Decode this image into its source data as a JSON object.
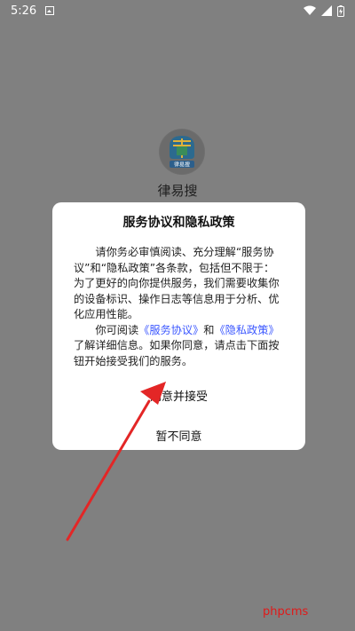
{
  "status_bar": {
    "time": "5:26"
  },
  "app": {
    "name": "律易搜",
    "logo_text": "律易搜"
  },
  "dialog": {
    "title": "服务协议和隐私政策",
    "para1": "请你务必审慎阅读、充分理解“服务协议”和“隐私政策”各条款，包括但不限于：为了更好的向你提供服务，我们需要收集你的设备标识、操作日志等信息用于分析、优化应用性能。",
    "para2_before": "你可阅读",
    "link_service": "《服务协议》",
    "para2_mid": "和",
    "link_privacy": "《隐私政策》",
    "para2_after": "了解详细信息。如果你同意，请点击下面按钮开始接受我们的服务。",
    "accept": "同意并接受",
    "decline": "暂不同意"
  },
  "watermark": "phpcms",
  "colors": {
    "overlay": "#808080",
    "link": "#3b57ff",
    "arrow": "#e32626",
    "watermark": "#e01919"
  }
}
